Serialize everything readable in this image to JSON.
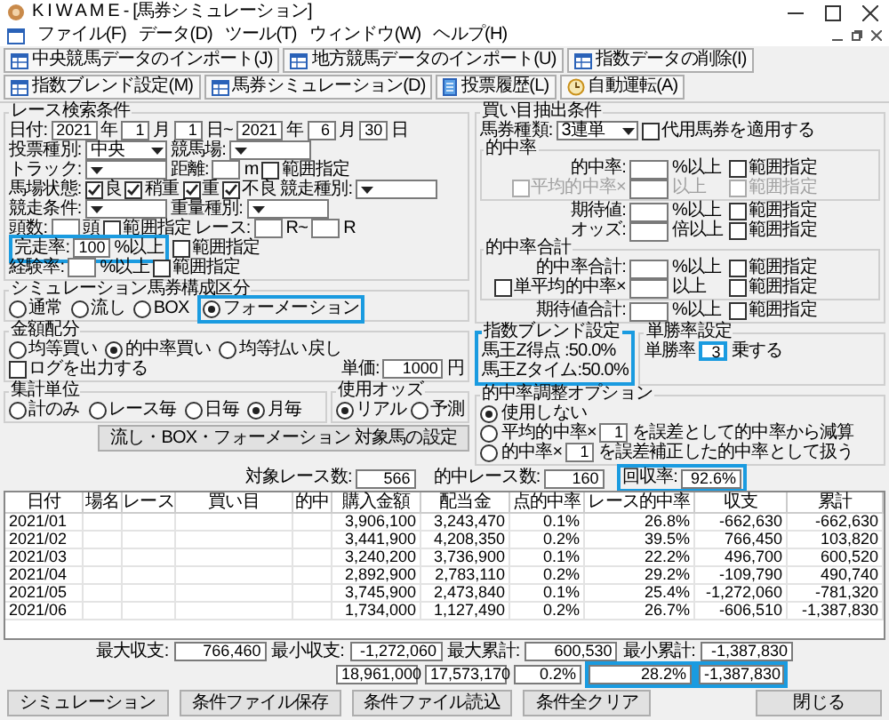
{
  "window": {
    "title": "K I W A M E - [馬券シミュレーション]"
  },
  "menu": [
    "ファイル(F)",
    "データ(D)",
    "ツール(T)",
    "ウィンドウ(W)",
    "ヘルプ(H)"
  ],
  "toolbar": [
    {
      "label": "中央競馬データのインポート(J)",
      "kind": "table"
    },
    {
      "label": "地方競馬データのインポート(U)",
      "kind": "table"
    },
    {
      "label": "指数データの削除(I)",
      "kind": "table"
    },
    {
      "label": "指数ブレンド設定(M)",
      "kind": "table"
    },
    {
      "label": "馬券シミュレーション(D)",
      "kind": "table"
    },
    {
      "label": "投票履歴(L)",
      "kind": "document"
    },
    {
      "label": "自動運転(A)",
      "kind": "clock"
    }
  ],
  "race_search": {
    "legend": "レース検索条件",
    "lines": [
      {
        "items": [
          {
            "kind": "label",
            "text": "日付:"
          },
          {
            "kind": "input",
            "value": "2021"
          },
          {
            "kind": "label",
            "text": "年"
          },
          {
            "kind": "input",
            "value": "1"
          },
          {
            "kind": "label",
            "text": "月"
          },
          {
            "kind": "input",
            "value": "1"
          },
          {
            "kind": "label",
            "text": "日~"
          },
          {
            "kind": "input",
            "value": "2021"
          },
          {
            "kind": "label",
            "text": "年"
          },
          {
            "kind": "input",
            "value": "6"
          },
          {
            "kind": "label",
            "text": "月"
          },
          {
            "kind": "input",
            "value": "30"
          },
          {
            "kind": "label",
            "text": "日"
          }
        ]
      },
      {
        "items": [
          {
            "kind": "label",
            "text": "投票種別:"
          },
          {
            "kind": "select",
            "value": "中央"
          },
          {
            "kind": "label",
            "text": "競馬場:"
          },
          {
            "kind": "select"
          }
        ]
      },
      {
        "items": [
          {
            "kind": "label",
            "text": "トラック:"
          },
          {
            "kind": "select"
          },
          {
            "kind": "label",
            "text": "距離:"
          },
          {
            "kind": "input"
          },
          {
            "kind": "label",
            "text": "m"
          },
          {
            "kind": "check",
            "label": "範囲指定",
            "checked": false
          }
        ]
      },
      {
        "items": [
          {
            "kind": "label",
            "text": "馬場状態:"
          },
          {
            "kind": "check",
            "label": "良",
            "checked": true
          },
          {
            "kind": "check",
            "label": "稍重",
            "checked": true
          },
          {
            "kind": "check",
            "label": "重",
            "checked": true
          },
          {
            "kind": "check",
            "label": "不良",
            "checked": true
          },
          {
            "kind": "label",
            "text": "競走種別:"
          },
          {
            "kind": "select"
          }
        ]
      },
      {
        "items": [
          {
            "kind": "label",
            "text": "競走条件:"
          },
          {
            "kind": "select"
          },
          {
            "kind": "label",
            "text": "重量種別:"
          },
          {
            "kind": "select"
          }
        ]
      },
      {
        "items": [
          {
            "kind": "label",
            "text": "頭数:"
          },
          {
            "kind": "input"
          },
          {
            "kind": "label",
            "text": "頭"
          },
          {
            "kind": "check",
            "label": "範囲指定",
            "checked": false
          },
          {
            "kind": "label",
            "text": "レース:"
          },
          {
            "kind": "input"
          },
          {
            "kind": "label",
            "text": "R~"
          },
          {
            "kind": "input"
          },
          {
            "kind": "label",
            "text": "R"
          }
        ]
      },
      {
        "items": [
          {
            "kind": "group",
            "highlighted": true,
            "items": [
              {
                "kind": "label",
                "text": "完走率:"
              },
              {
                "kind": "input",
                "value": "100"
              },
              {
                "kind": "label",
                "text": "%以上"
              }
            ]
          },
          {
            "kind": "check",
            "label": "範囲指定",
            "checked": false
          }
        ]
      },
      {
        "items": [
          {
            "kind": "label",
            "text": "経験率:"
          },
          {
            "kind": "input"
          },
          {
            "kind": "label",
            "text": "%以上"
          },
          {
            "kind": "check",
            "label": "範囲指定",
            "checked": false
          }
        ]
      }
    ]
  },
  "bet_conditions": {
    "legend": "買い目抽出条件",
    "bet_type_label": "馬券種類:",
    "bet_type": "3連単",
    "substitute": {
      "label": "代用馬券を適用する",
      "checked": false
    },
    "sections": [
      {
        "legend": "的中率",
        "rows": [
          {
            "label": "的中率:",
            "suffix": "%以上",
            "range_label": "範囲指定",
            "range_checked": false,
            "disabled": false
          },
          {
            "label": "平均的中率×",
            "toggle_checked": false,
            "suffix": "以上",
            "range_label": "範囲指定",
            "range_checked": false,
            "disabled": true
          }
        ]
      },
      {
        "rows": [
          {
            "label": "期待値:",
            "suffix": "%以上",
            "range_label": "範囲指定",
            "range_checked": false,
            "disabled": false
          },
          {
            "label": "オッズ:",
            "suffix": "倍以上",
            "range_label": "範囲指定",
            "range_checked": false,
            "disabled": false
          }
        ]
      },
      {
        "legend": "的中率合計",
        "rows": [
          {
            "label": "的中率合計:",
            "suffix": "%以上",
            "range_label": "範囲指定",
            "range_checked": false,
            "disabled": false
          },
          {
            "label": "単平均的中率×",
            "toggle_checked": false,
            "suffix": "以上",
            "range_label": "範囲指定",
            "range_checked": false,
            "disabled": false
          }
        ]
      },
      {
        "rows": [
          {
            "label": "期待値合計:",
            "suffix": "%以上",
            "range_label": "範囲指定",
            "range_checked": false,
            "disabled": false
          }
        ]
      }
    ]
  },
  "sim_type": {
    "legend": "シミュレーション馬券構成区分",
    "options": [
      {
        "label": "通常",
        "selected": false,
        "highlighted": false
      },
      {
        "label": "流し",
        "selected": false,
        "highlighted": false
      },
      {
        "label": "BOX",
        "selected": false,
        "highlighted": false
      },
      {
        "label": "フォーメーション",
        "selected": true,
        "highlighted": true
      }
    ]
  },
  "target_button": "流し・BOX・フォーメーション 対象馬の設定",
  "allocation": {
    "legend": "金額配分",
    "options": [
      {
        "label": "均等買い",
        "selected": false
      },
      {
        "label": "的中率買い",
        "selected": true
      },
      {
        "label": "均等払い戻し",
        "selected": false
      }
    ],
    "unit_label": "単価:",
    "unit_value": "1000",
    "unit_suffix": "円"
  },
  "odds": {
    "legend": "使用オッズ",
    "options": [
      {
        "label": "リアル",
        "selected": true
      },
      {
        "label": "予測",
        "selected": false
      }
    ]
  },
  "aggregation": {
    "legend": "集計単位",
    "options": [
      {
        "label": "計のみ",
        "selected": false
      },
      {
        "label": "レース毎",
        "selected": false
      },
      {
        "label": "日毎",
        "selected": false
      },
      {
        "label": "月毎",
        "selected": true
      }
    ]
  },
  "log_output": {
    "label": "ログを出力する",
    "checked": false
  },
  "blend": {
    "legend": "指数ブレンド設定",
    "lines": [
      "馬王Z得点 :50.0%",
      "馬王Zタイム:50.0%"
    ],
    "highlighted": true
  },
  "win_rate": {
    "legend": "単勝率設定",
    "label": "単勝率",
    "value": "3",
    "suffix": "乗する",
    "highlighted": true
  },
  "adjust": {
    "legend": "的中率調整オプション",
    "options": [
      {
        "selected": true,
        "parts": [
          {
            "kind": "label",
            "text": "使用しない"
          }
        ]
      },
      {
        "selected": false,
        "parts": [
          {
            "kind": "label",
            "text": "平均的中率×"
          },
          {
            "kind": "input",
            "value": "1"
          },
          {
            "kind": "label",
            "text": "を誤差として的中率から減算"
          }
        ]
      },
      {
        "selected": false,
        "parts": [
          {
            "kind": "label",
            "text": "的中率×"
          },
          {
            "kind": "input",
            "value": "1"
          },
          {
            "kind": "label",
            "text": "を誤差補正した的中率として扱う"
          }
        ]
      }
    ]
  },
  "stats": [
    {
      "label": "対象レース数:",
      "value": "566",
      "highlighted": false
    },
    {
      "label": "的中レース数:",
      "value": "160",
      "highlighted": false
    },
    {
      "label": "回収率:",
      "value": "92.6%",
      "highlighted": true
    }
  ],
  "table": {
    "columns": [
      "日付",
      "場名",
      "レース",
      "買い目",
      "的中",
      "購入金額",
      "配当金",
      "点的中率",
      "レース的中率",
      "収支",
      "累計"
    ],
    "rows": [
      {
        "date": "2021/01",
        "purchase": "3,906,100",
        "payout": "3,243,470",
        "point_hit_rate": "0.1%",
        "race_hit_rate": "26.8%",
        "balance": "-662,630",
        "cumulative": "-662,630"
      },
      {
        "date": "2021/02",
        "purchase": "3,441,900",
        "payout": "4,208,350",
        "point_hit_rate": "0.2%",
        "race_hit_rate": "39.5%",
        "balance": "766,450",
        "cumulative": "103,820"
      },
      {
        "date": "2021/03",
        "purchase": "3,240,200",
        "payout": "3,736,900",
        "point_hit_rate": "0.1%",
        "race_hit_rate": "22.2%",
        "balance": "496,700",
        "cumulative": "600,520"
      },
      {
        "date": "2021/04",
        "purchase": "2,892,900",
        "payout": "2,783,110",
        "point_hit_rate": "0.2%",
        "race_hit_rate": "29.2%",
        "balance": "-109,790",
        "cumulative": "490,740"
      },
      {
        "date": "2021/05",
        "purchase": "3,745,900",
        "payout": "2,473,840",
        "point_hit_rate": "0.1%",
        "race_hit_rate": "25.4%",
        "balance": "-1,272,060",
        "cumulative": "-781,320"
      },
      {
        "date": "2021/06",
        "purchase": "1,734,000",
        "payout": "1,127,490",
        "point_hit_rate": "0.2%",
        "race_hit_rate": "26.7%",
        "balance": "-606,510",
        "cumulative": "-1,387,830"
      }
    ]
  },
  "summary": {
    "stats": [
      {
        "label": "最大収支:",
        "value": "766,460"
      },
      {
        "label": "最小収支:",
        "value": "-1,272,060"
      },
      {
        "label": "最大累計:",
        "value": "600,530"
      },
      {
        "label": "最小累計:",
        "value": "-1,387,830"
      }
    ],
    "totals": [
      {
        "value": "18,961,000",
        "highlighted": false
      },
      {
        "value": "17,573,170",
        "highlighted": false
      },
      {
        "value": "0.2%",
        "highlighted": false
      },
      {
        "value": "28.2%",
        "highlighted": true
      },
      {
        "value": "-1,387,830",
        "highlighted": true
      }
    ]
  },
  "buttons": [
    "シミュレーション",
    "条件ファイル保存",
    "条件ファイル読込",
    "条件全クリア"
  ],
  "close_button": "閉じる"
}
